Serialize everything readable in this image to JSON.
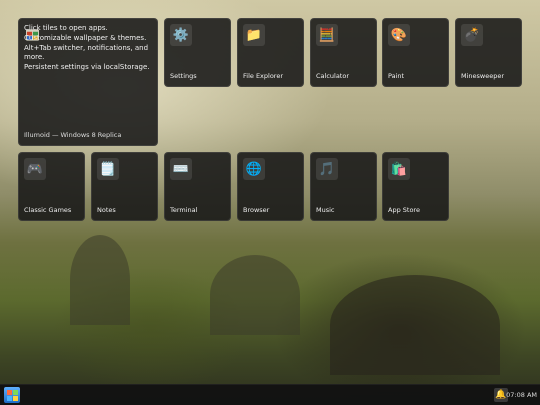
{
  "wallpaper": {
    "description_colors": [
      "#cfc8a4",
      "#5c6a2e",
      "#2c2f1e"
    ]
  },
  "intro_tile": {
    "lines": [
      "Click tiles to open apps.",
      "Customizable wallpaper & themes.",
      "Alt+Tab switcher, notifications, and more.",
      "Persistent settings via localStorage."
    ],
    "subtitle": "Illumoid — Windows 8 Replica"
  },
  "tiles": [
    {
      "label": "Settings",
      "icon": "gear-icon",
      "glyph": "⚙️"
    },
    {
      "label": "File Explorer",
      "icon": "folder-icon",
      "glyph": "📁"
    },
    {
      "label": "Calculator",
      "icon": "abacus-icon",
      "glyph": "🧮"
    },
    {
      "label": "Paint",
      "icon": "palette-icon",
      "glyph": "🎨"
    },
    {
      "label": "Minesweeper",
      "icon": "bomb-icon",
      "glyph": "💣"
    },
    {
      "label": "Classic Games",
      "icon": "gamepad-icon",
      "glyph": "🎮"
    },
    {
      "label": "Notes",
      "icon": "notepad-icon",
      "glyph": "🗒️"
    },
    {
      "label": "Terminal",
      "icon": "keyboard-icon",
      "glyph": "⌨️"
    },
    {
      "label": "Browser",
      "icon": "globe-icon",
      "glyph": "🌐"
    },
    {
      "label": "Music",
      "icon": "music-note-icon",
      "glyph": "🎵"
    },
    {
      "label": "App Store",
      "icon": "shopping-bags-icon",
      "glyph": "🛍️"
    }
  ],
  "taskbar": {
    "start_icon": "windows-logo-icon",
    "notification_icon": "bell-icon",
    "notification_glyph": "🔔",
    "clock": "07:08 AM"
  }
}
